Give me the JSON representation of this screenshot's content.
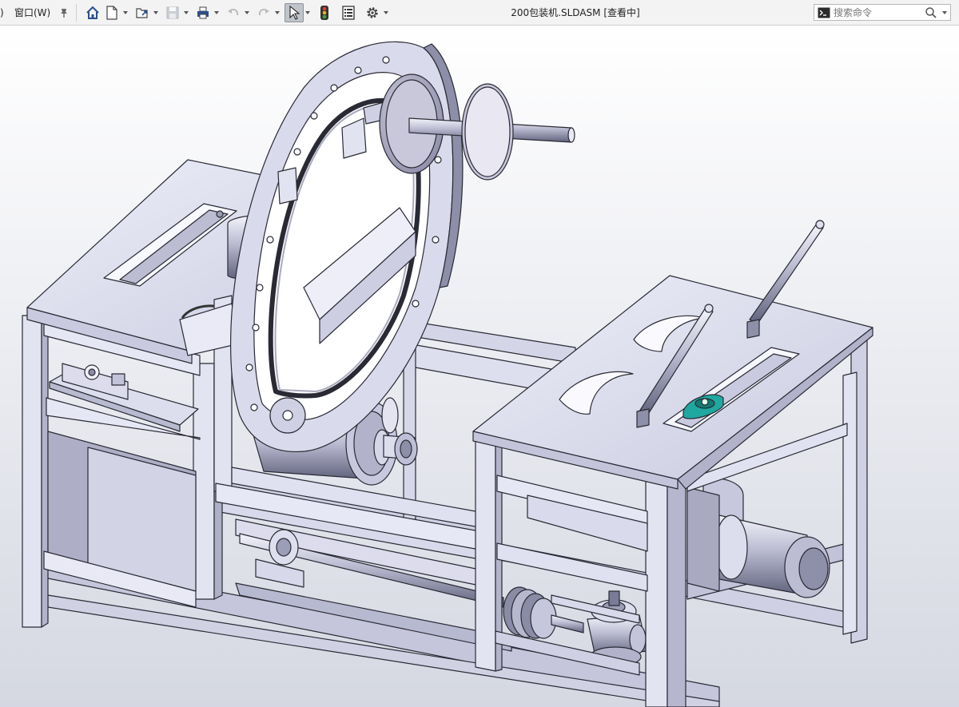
{
  "toolbar": {
    "menu_fragment": ")",
    "window_menu": "窗口(W)",
    "items": [
      {
        "icon": "home-icon"
      },
      {
        "icon": "new-document-icon"
      },
      {
        "icon": "open-folder-icon"
      },
      {
        "icon": "save-icon"
      },
      {
        "icon": "print-icon"
      },
      {
        "icon": "undo-icon"
      },
      {
        "icon": "redo-icon"
      },
      {
        "icon": "select-pointer-icon"
      },
      {
        "icon": "rebuild-traffic-light-icon"
      },
      {
        "icon": "file-properties-icon"
      },
      {
        "icon": "options-gear-icon"
      }
    ]
  },
  "window": {
    "title": "200包装机.SLDASM [查看中]"
  },
  "search": {
    "placeholder": "搜索命令"
  },
  "view_toolbar": {
    "items": [
      "zoom-to-fit-icon",
      "zoom-to-area-icon",
      "previous-view-icon",
      "section-view-icon",
      "view-orientation-icon",
      "display-style-icon",
      "hide-show-items-icon",
      "edit-appearance-icon",
      "apply-scene-icon",
      "view-settings-icon"
    ]
  },
  "colors": {
    "model_fill": "#d7d8ea",
    "model_dark": "#8b8ca6",
    "edge": "#2a2a35",
    "accent_bearing": "#1fa8a0",
    "background_top": "#ffffff",
    "background_bottom": "#d5d8e2"
  }
}
